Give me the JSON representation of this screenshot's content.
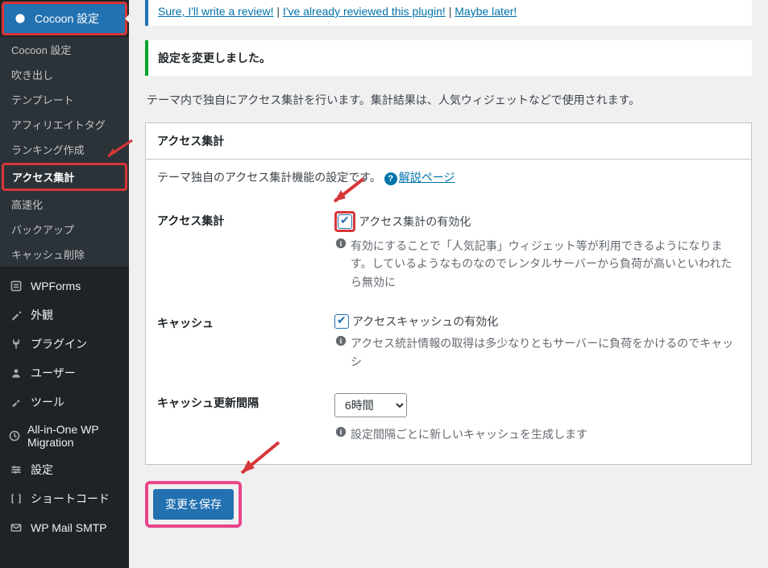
{
  "sidebar": {
    "current": "Cocoon 設定",
    "submenu": [
      "Cocoon 設定",
      "吹き出し",
      "テンプレート",
      "アフィリエイトタグ",
      "ランキング作成",
      "アクセス集計",
      "高速化",
      "バックアップ",
      "キャッシュ削除"
    ],
    "menu": [
      "WPForms",
      "外観",
      "プラグイン",
      "ユーザー",
      "ツール",
      "All-in-One WP Migration",
      "設定",
      "ショートコード",
      "WP Mail SMTP"
    ]
  },
  "notice": {
    "review": "Sure, I'll write a review!",
    "already": "I've already reviewed this plugin!",
    "later": "Maybe later!",
    "sep": " | "
  },
  "success": "設定を変更しました。",
  "desc": "テーマ内で独自にアクセス集計を行います。集計結果は、人気ウィジェットなどで使用されます。",
  "panel": {
    "title": "アクセス集計",
    "lead": "テーマ独自のアクセス集計機能の設定です。",
    "help": "解説ページ",
    "rows": {
      "access": {
        "label": "アクセス集計",
        "checkbox": "アクセス集計の有効化",
        "info": "有効にすることで「人気記事」ウィジェット等が利用できるようになります。しているようなものなのでレンタルサーバーから負荷が高いといわれたら無効に"
      },
      "cache": {
        "label": "キャッシュ",
        "checkbox": "アクセスキャッシュの有効化",
        "info": "アクセス統計情報の取得は多少なりともサーバーに負荷をかけるのでキャッシ"
      },
      "interval": {
        "label": "キャッシュ更新間隔",
        "selected": "6時間",
        "info": "設定間隔ごとに新しいキャッシュを生成します"
      }
    }
  },
  "save": "変更を保存"
}
